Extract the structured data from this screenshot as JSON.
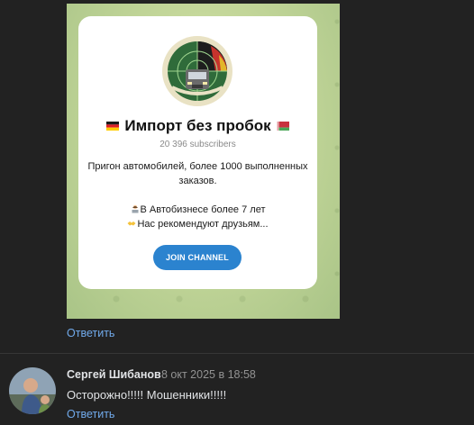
{
  "preview": {
    "channel_title": "Импорт без пробок",
    "subscribers": "20 396 subscribers",
    "description_line1": "Пригон автомобилей, более 1000 выполненных заказов.",
    "description_line2": "В Автобизнесе более 7 лет",
    "description_line3": "Нас рекомендуют друзьям...",
    "join_button": "JOIN CHANNEL",
    "flags": [
      "germany-flag",
      "belarus-flag"
    ],
    "icons": [
      "person-laptop-emoji",
      "handshake-emoji"
    ],
    "colors": {
      "button": "#2b83cf",
      "card_bg": "#ffffff",
      "pattern_bg": "#c4d79a"
    }
  },
  "reply_link_1": "Ответить",
  "comment": {
    "author": "Сергей Шибанов",
    "date": "8 окт 2025 в 18:58",
    "text": "Осторожно!!!!! Мошенники!!!!!",
    "reply_label": "Ответить"
  },
  "theme": {
    "page_bg": "#222222",
    "link_color": "#71aaeb",
    "text_color": "#e1e3e6",
    "muted_color": "#939393"
  }
}
